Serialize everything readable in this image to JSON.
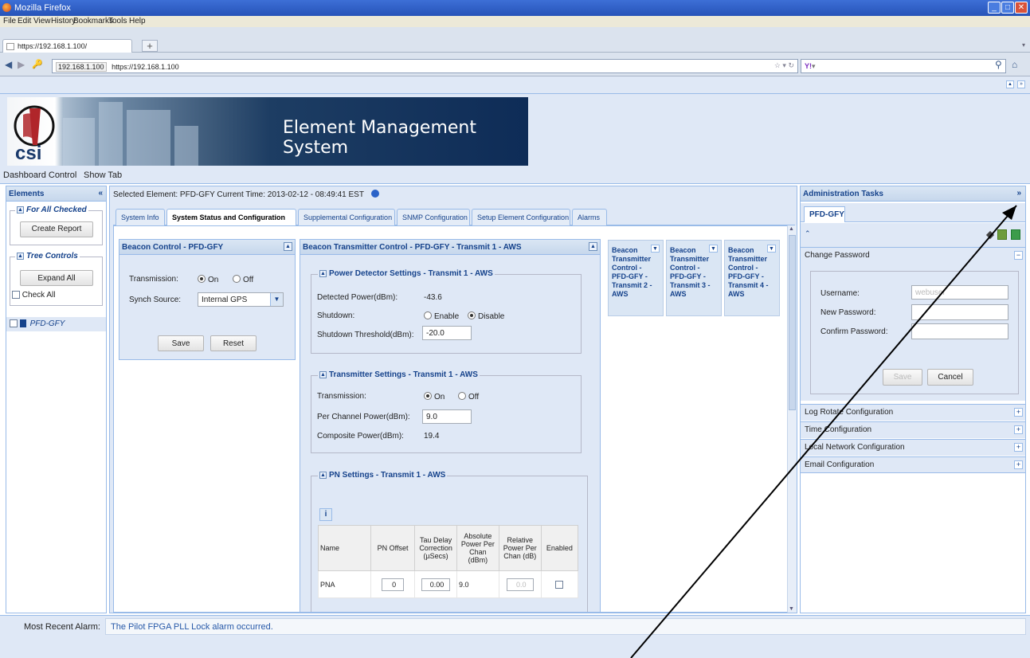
{
  "browser": {
    "title": "Mozilla Firefox",
    "menu": [
      "File",
      "Edit",
      "View",
      "History",
      "Bookmarks",
      "Tools",
      "Help"
    ],
    "tab_label": "https://192.168.1.100/",
    "new_tab": "+",
    "url_site": "192.168.1.100",
    "url": "https://192.168.1.100",
    "search_placeholder": ""
  },
  "banner": {
    "logo_text": "csi",
    "title": "Element Management System"
  },
  "appmenu": {
    "dashboard": "Dashboard Control",
    "show_tab": "Show Tab"
  },
  "left": {
    "title": "Elements",
    "for_all": "For All Checked",
    "create_report": "Create Report",
    "tree_controls": "Tree Controls",
    "expand_all": "Expand All",
    "check_all": "Check All",
    "tree_item": "PFD-GFY"
  },
  "center": {
    "selected": "Selected Element:  PFD-GFY  Current Time: 2013-02-12 - 08:49:41 EST",
    "tabs": [
      "System Info",
      "System Status and Configuration",
      "Supplemental Configuration",
      "SNMP Configuration",
      "Setup Element Configuration",
      "Alarms"
    ],
    "beacon": {
      "title": "Beacon Control - PFD-GFY",
      "transmission_label": "Transmission:",
      "on": "On",
      "off": "Off",
      "synch_label": "Synch Source:",
      "synch_value": "Internal GPS",
      "save": "Save",
      "reset": "Reset"
    },
    "btc": {
      "title": "Beacon Transmitter Control - PFD-GFY - Transmit 1 - AWS",
      "pd": {
        "title": "Power Detector Settings - Transmit 1 - AWS",
        "detected_label": "Detected Power(dBm):",
        "detected_value": "-43.6",
        "shutdown_label": "Shutdown:",
        "enable": "Enable",
        "disable": "Disable",
        "threshold_label": "Shutdown Threshold(dBm):",
        "threshold_value": "-20.0"
      },
      "ts": {
        "title": "Transmitter Settings - Transmit 1 - AWS",
        "transmission_label": "Transmission:",
        "on": "On",
        "off": "Off",
        "per_channel_label": "Per Channel Power(dBm):",
        "per_channel_value": "9.0",
        "composite_label": "Composite Power(dBm):",
        "composite_value": "19.4"
      },
      "pn": {
        "title": "PN Settings - Transmit 1 - AWS",
        "headers": [
          "Name",
          "PN Offset",
          "Tau Delay Correction (µSecs)",
          "Absolute Power Per Chan (dBm)",
          "Relative Power Per Chan (dB)",
          "Enabled"
        ],
        "row": {
          "name": "PNA",
          "offset": "0",
          "tau": "0.00",
          "abs": "9.0",
          "rel": "0.0"
        }
      }
    },
    "cards": [
      {
        "l1": "Beacon",
        "l2": "Transmitter",
        "l3": "Control -",
        "l4": "PFD-GFY -",
        "l5": "Transmit 2 -",
        "l6": "AWS"
      },
      {
        "l1": "Beacon",
        "l2": "Transmitter",
        "l3": "Control -",
        "l4": "PFD-GFY -",
        "l5": "Transmit 3 -",
        "l6": "AWS"
      },
      {
        "l1": "Beacon",
        "l2": "Transmitter",
        "l3": "Control -",
        "l4": "PFD-GFY -",
        "l5": "Transmit 4 -",
        "l6": "AWS"
      }
    ]
  },
  "right": {
    "title": "Administration Tasks",
    "tab": "PFD-GFY",
    "change_password": "Change Password",
    "username_label": "Username:",
    "username_value": "webuser",
    "new_password_label": "New Password:",
    "confirm_password_label": "Confirm Password:",
    "save": "Save",
    "cancel": "Cancel",
    "sections": [
      "Log Rotate Configuration",
      "Time Configuration",
      "Local Network Configuration",
      "Email Configuration"
    ]
  },
  "status": {
    "label": "Most Recent Alarm:",
    "message": "The Pilot FPGA PLL Lock alarm occurred."
  },
  "colors": {
    "accent": "#15428b",
    "panel": "#dfe8f6",
    "border": "#99bbe8",
    "alarm_text": "#2658a8"
  }
}
